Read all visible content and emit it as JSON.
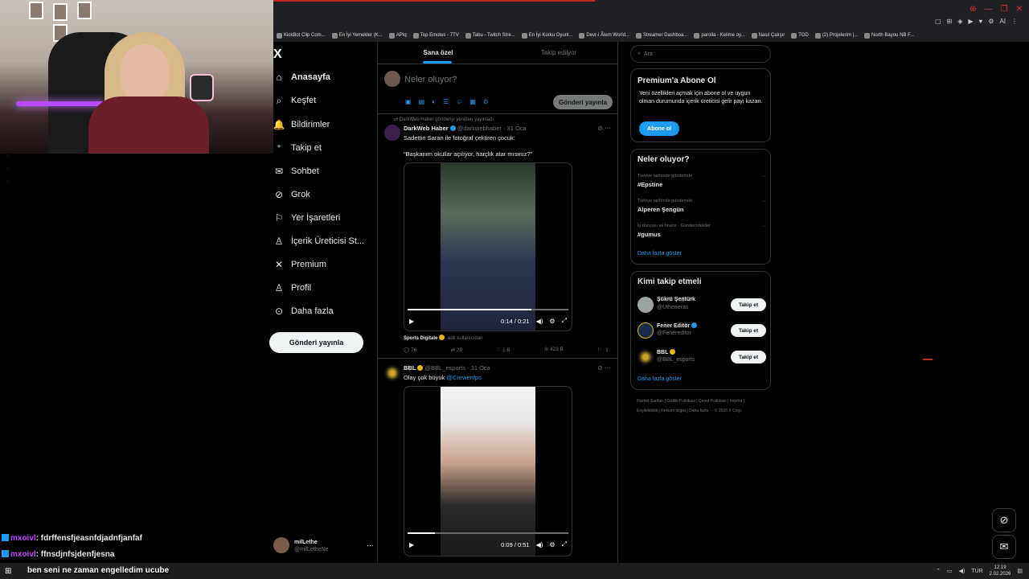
{
  "browser": {
    "bookmarks": [
      "KickBot Clip Com...",
      "En İyi Yemekler (K...",
      "APIq",
      "Top Emotes - 7TV",
      "Tabu - Twitch Stre...",
      "En İyi Korku Oyunl...",
      "Devr-i Âlem World...",
      "Streamer Dashboa...",
      "parolla - Kelime oy...",
      "Nasıl Çalışır",
      "TOD",
      "(2) Projelerim |...",
      "North Bayou NB F..."
    ],
    "window_controls": [
      "⊕",
      "—",
      "❐",
      "✕"
    ],
    "toolbar_icons": [
      "▢",
      "⊞",
      "◈",
      "▶",
      "♥",
      "⚙",
      "AI",
      "⋮"
    ],
    "accent": "#1d9bf0"
  },
  "x": {
    "logo": "X",
    "nav": [
      {
        "label": "Anasayfa",
        "icon": "⌂"
      },
      {
        "label": "Keşfet",
        "icon": "⌕"
      },
      {
        "label": "Bildirimler",
        "icon": "🔔"
      },
      {
        "label": "Takip et",
        "icon": "⁺"
      },
      {
        "label": "Sohbet",
        "icon": "✉"
      },
      {
        "label": "Grok",
        "icon": "⊘"
      },
      {
        "label": "Yer İşaretleri",
        "icon": "⚐"
      },
      {
        "label": "İçerik Üreticisi St...",
        "icon": "♙"
      },
      {
        "label": "Premium",
        "icon": "✕"
      },
      {
        "label": "Profil",
        "icon": "♙"
      },
      {
        "label": "Daha fazla",
        "icon": "⊙"
      }
    ],
    "post_button": "Gönderi yayınla",
    "account": {
      "name": "milLethe",
      "handle": "@milLetheNe",
      "more": "···"
    }
  },
  "feed": {
    "tabs": [
      "Sana özel",
      "Takip edilyor"
    ],
    "composer": {
      "placeholder": "Neler oluyor?",
      "post_button": "Gönderi yayınla",
      "tools": [
        "▣",
        "▤",
        "◐",
        "☰",
        "☺",
        "▦",
        "⊙"
      ]
    },
    "tweets": [
      {
        "repost_note": "DarkWeb Haber gönderiyi yeniden yayınladı",
        "name": "DarkWeb Haber",
        "handle": "@darkwebhaber · 31 Oca",
        "text1": "Sadettin Saran ile fotoğraf çektiren çocuk:",
        "text2": "\"Başkanım okullar açılıyor, harçlık atar mısınız?\"",
        "video_time": "0:14 / 0:21",
        "progress": 0.77,
        "source_name": "Sports Digitale",
        "source_suffix": "adlı kullanıcıdan",
        "stats": {
          "replies": "76",
          "reposts": "29",
          "likes": "1 B",
          "views": "423 B"
        }
      },
      {
        "name": "BBL",
        "handle": "@BBL_esports · 31 Oca",
        "text_prefix": "Olay çok büyük",
        "mention": "@Crewenfps",
        "video_time": "0:09 / 0:51",
        "progress": 0.17
      }
    ]
  },
  "right": {
    "search_placeholder": "Ara",
    "premium": {
      "title": "Premium'a Abone Ol",
      "body": "Yeni özellikleri açmak için abone ol ve uygun olman durumunda içerik üreticisi gelir payı kazan.",
      "button": "Abone ol"
    },
    "trends": {
      "title": "Neler oluyor?",
      "items": [
        {
          "category": "Türkiye tarihinde gündemde",
          "name": "#Epstine"
        },
        {
          "category": "Türkiye tarihinde gündemde",
          "name": "Alperen Şengün"
        },
        {
          "category": "İş dünyası ve finans · Gündemdekiler",
          "name": "#gumus"
        }
      ],
      "show_more": "Daha fazla göster"
    },
    "who_to_follow": {
      "title": "Kimi takip etmeli",
      "items": [
        {
          "name": "Şükrü Şentürk",
          "handle": "@Utheneras",
          "button": "Takip et"
        },
        {
          "name": "Fener Editör",
          "handle": "@Fenereditor",
          "button": "Takip et"
        },
        {
          "name": "BBL",
          "handle": "@BBL_esports",
          "button": "Takip et"
        }
      ],
      "show_more": "Daha fazla göster"
    },
    "footer": "Hizmet Şartları | Gizlilik Politikası | Çerez Politikası | Imprint | Erişilebilirlik | Reklam bilgisi | Daha fazla ··· © 2026 X Corp."
  },
  "chat": [
    {
      "user": "mxoivl",
      "message": ": fdrffensfjeasnfdjadnfjanfaf"
    },
    {
      "user": "mxoivl",
      "message": ": ffnsdjnfsjdenfjesna"
    },
    {
      "user": "",
      "message": "ben seni ne zaman engelledim ucube"
    }
  ],
  "taskbar": {
    "lang": "TUR",
    "time": "12:19",
    "date": "2.02.2026"
  }
}
